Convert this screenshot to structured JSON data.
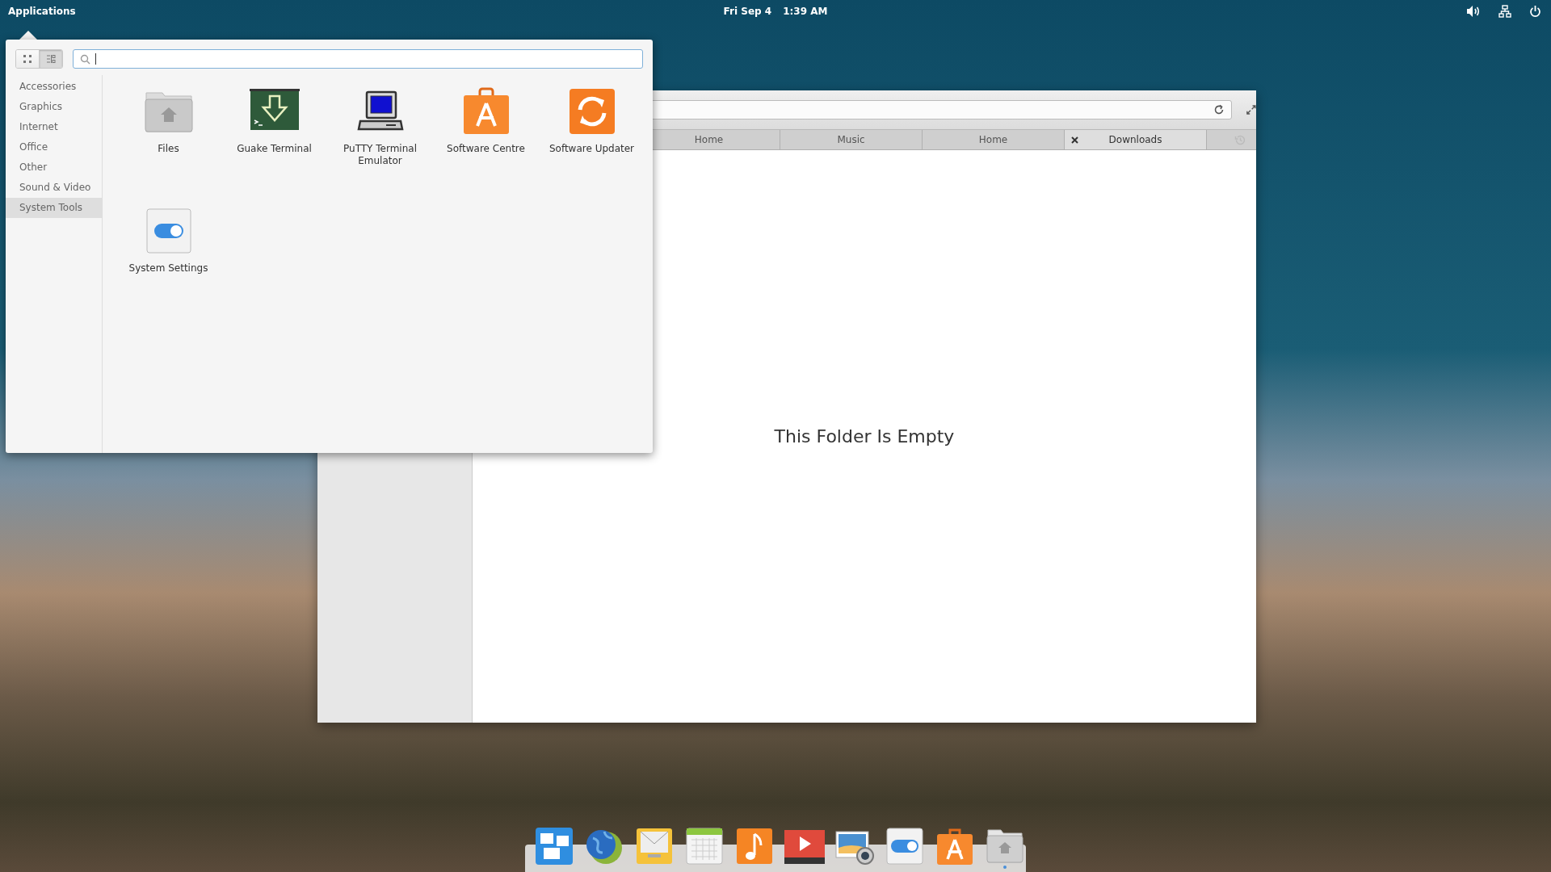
{
  "top_panel": {
    "applications_label": "Applications",
    "date": "Fri Sep 4",
    "time": "1:39 AM",
    "indicators": [
      {
        "kind": "sound"
      },
      {
        "kind": "network"
      },
      {
        "kind": "power"
      }
    ]
  },
  "app_menu": {
    "view_modes": [
      {
        "kind": "grid",
        "selected": false
      },
      {
        "kind": "list",
        "selected": true
      }
    ],
    "categories": [
      {
        "label": "Accessories",
        "selected": false
      },
      {
        "label": "Graphics",
        "selected": false
      },
      {
        "label": "Internet",
        "selected": false
      },
      {
        "label": "Office",
        "selected": false
      },
      {
        "label": "Other",
        "selected": false
      },
      {
        "label": "Sound & Video",
        "selected": false
      },
      {
        "label": "System Tools",
        "selected": true
      }
    ],
    "apps": [
      {
        "name": "Files",
        "kind": "folder"
      },
      {
        "name": "Guake Terminal",
        "kind": "terminal"
      },
      {
        "name": "PuTTY Terminal Emulator",
        "kind": "computer"
      },
      {
        "name": "Software Centre",
        "kind": "bag"
      },
      {
        "name": "Software Updater",
        "kind": "updater"
      },
      {
        "name": "System Settings",
        "kind": "toggle"
      }
    ]
  },
  "file_manager": {
    "tabs": [
      {
        "label": "Home",
        "selected": false
      },
      {
        "label": "Music",
        "selected": false
      },
      {
        "label": "Home",
        "selected": false
      },
      {
        "label": "Downloads",
        "selected": true
      }
    ],
    "empty_message": "This Folder Is Empty"
  },
  "dock": {
    "items": [
      {
        "kind": "multitask",
        "running": false
      },
      {
        "kind": "browser",
        "running": false
      },
      {
        "kind": "mail",
        "running": false
      },
      {
        "kind": "calendar",
        "running": false
      },
      {
        "kind": "music",
        "running": false
      },
      {
        "kind": "video",
        "running": false
      },
      {
        "kind": "photos",
        "running": false
      },
      {
        "kind": "toggle",
        "running": false
      },
      {
        "kind": "bag",
        "running": false
      },
      {
        "kind": "folder",
        "running": true
      }
    ]
  }
}
